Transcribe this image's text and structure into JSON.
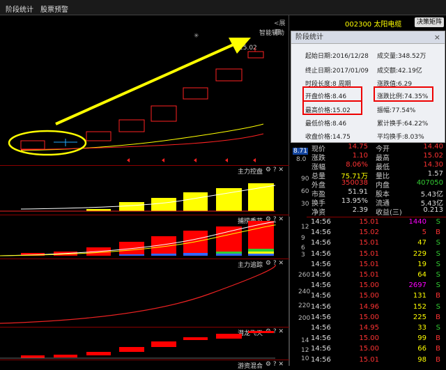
{
  "tabs": [
    "阶段统计",
    "股票预警"
  ],
  "expand_label": "<展开",
  "stock": {
    "code_name": "002300 太阳电缆",
    "flow_button": "决策矩阵"
  },
  "assist_label": "智能辅助",
  "price_tag": "15.02",
  "axis_top": {
    "v1": "8.71",
    "v2": "8.0"
  },
  "panes": [
    {
      "name": "主力控盘",
      "axis": [
        "90",
        "60",
        "30"
      ]
    },
    {
      "name": "捕捞季节",
      "axis": [
        "12",
        "9",
        "6",
        "3"
      ]
    },
    {
      "name": "主力追踪",
      "axis": [
        "260",
        "240",
        "220",
        "200"
      ]
    },
    {
      "name": "潜龙飞天",
      "axis": [
        "14",
        "12",
        "10"
      ]
    },
    {
      "name": "游资混合",
      "axis": []
    }
  ],
  "popup": {
    "title": "阶段统计",
    "close": "×",
    "items": [
      {
        "l": "起始日期:2016/12/28",
        "r": "成交量:348.52万"
      },
      {
        "l": "终止日期:2017/01/09",
        "r": "成交额:42.19亿"
      },
      {
        "l": "时段长度:8 周期",
        "r": "涨跌值:6.29"
      },
      {
        "l": "开盘价格:8.46",
        "r": "涨跌比例:74.35%"
      },
      {
        "l": "最高价格:15.02",
        "r": "振幅:77.54%"
      },
      {
        "l": "最低价格:8.46",
        "r": "累计换手:64.22%"
      },
      {
        "l": "收盘价格:14.75",
        "r": "平均换手:8.03%"
      }
    ]
  },
  "quote": [
    {
      "l1": "现价",
      "v1": "14.75",
      "c1": "red",
      "l2": "今开",
      "v2": "14.40",
      "c2": "red"
    },
    {
      "l1": "涨跌",
      "v1": "1.10",
      "c1": "red",
      "l2": "最高",
      "v2": "15.02",
      "c2": "red"
    },
    {
      "l1": "涨幅",
      "v1": "8.06%",
      "c1": "red",
      "l2": "最低",
      "v2": "14.30",
      "c2": "red"
    },
    {
      "l1": "总量",
      "v1": "75.71万",
      "c1": "yel",
      "l2": "量比",
      "v2": "1.57",
      "c2": "wht"
    },
    {
      "l1": "外盘",
      "v1": "350038",
      "c1": "red",
      "l2": "内盘",
      "v2": "407050",
      "c2": "grn"
    },
    {
      "l1": "市盈",
      "v1": "51.91",
      "c1": "wht",
      "l2": "股本",
      "v2": "5.43亿",
      "c2": "wht"
    },
    {
      "l1": "换手",
      "v1": "13.95%",
      "c1": "wht",
      "l2": "流通",
      "v2": "5.43亿",
      "c2": "wht"
    },
    {
      "l1": "净资",
      "v1": "2.39",
      "c1": "wht",
      "l2": "收益(三)",
      "v2": "0.213",
      "c2": "wht"
    }
  ],
  "ticks": [
    {
      "t": "14:56",
      "p": "15.01",
      "v": "1440",
      "vc": "mag",
      "d": "S",
      "dc": "grn"
    },
    {
      "t": "14:56",
      "p": "15.02",
      "v": "5",
      "vc": "red",
      "d": "B",
      "dc": "red"
    },
    {
      "t": "14:56",
      "p": "15.01",
      "v": "47",
      "vc": "yel",
      "d": "S",
      "dc": "grn"
    },
    {
      "t": "14:56",
      "p": "15.01",
      "v": "229",
      "vc": "yel",
      "d": "S",
      "dc": "grn"
    },
    {
      "t": "14:56",
      "p": "15.01",
      "v": "19",
      "vc": "yel",
      "d": "S",
      "dc": "grn"
    },
    {
      "t": "14:56",
      "p": "15.01",
      "v": "64",
      "vc": "yel",
      "d": "S",
      "dc": "grn"
    },
    {
      "t": "14:56",
      "p": "15.00",
      "v": "2697",
      "vc": "mag",
      "d": "S",
      "dc": "grn"
    },
    {
      "t": "14:56",
      "p": "15.00",
      "v": "131",
      "vc": "yel",
      "d": "B",
      "dc": "red"
    },
    {
      "t": "14:56",
      "p": "14.96",
      "v": "152",
      "vc": "yel",
      "d": "S",
      "dc": "grn"
    },
    {
      "t": "14:56",
      "p": "15.00",
      "v": "225",
      "vc": "yel",
      "d": "B",
      "dc": "red"
    },
    {
      "t": "14:56",
      "p": "14.95",
      "v": "33",
      "vc": "yel",
      "d": "S",
      "dc": "grn"
    },
    {
      "t": "14:56",
      "p": "15.00",
      "v": "99",
      "vc": "yel",
      "d": "B",
      "dc": "red"
    },
    {
      "t": "14:56",
      "p": "15.00",
      "v": "66",
      "vc": "yel",
      "d": "B",
      "dc": "red"
    },
    {
      "t": "14:56",
      "p": "15.01",
      "v": "98",
      "vc": "yel",
      "d": "B",
      "dc": "red"
    }
  ]
}
